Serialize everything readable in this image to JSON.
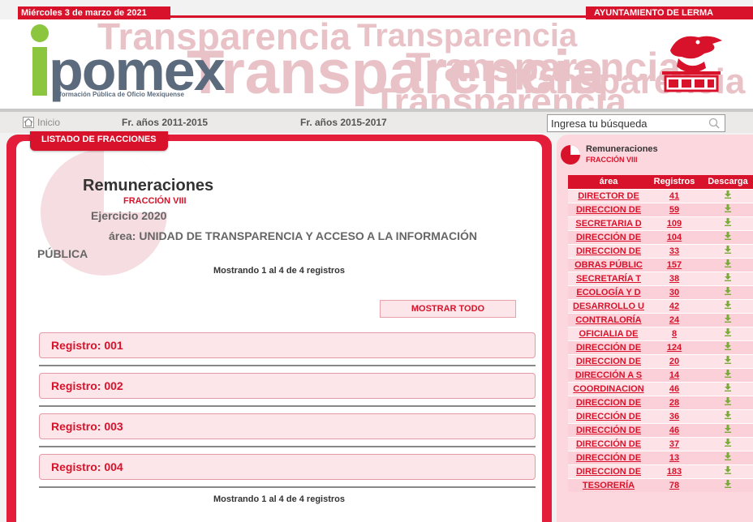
{
  "topbar": {
    "date": "Miércoles 3 de marzo de 2021",
    "ayuntamiento": "AYUNTAMIENTO DE LERMA"
  },
  "banner": {
    "logo_word": "pomex",
    "logo_sub": "Información Pública de Oficio Mexiquense",
    "watermark": "Transparencia"
  },
  "nav": {
    "home": "Inicio",
    "link1": "Fr. años 2011-2015",
    "link2": "Fr. años 2015-2017",
    "search_placeholder": "Ingresa tu búsqueda"
  },
  "main": {
    "tab": "LISTADO DE FRACCIONES",
    "title": "Remuneraciones",
    "fraccion": "FRACCIÓN VIII",
    "ejercicio": "Ejercicio 2020",
    "area": "área: UNIDAD DE TRANSPARENCIA Y ACCESO A LA INFORMACIÓN PÚBLICA",
    "mostrando": "Mostrando 1 al 4 de 4 registros",
    "mostrar_todo": "MOSTRAR TODO",
    "registros": [
      "Registro: 001",
      "Registro: 002",
      "Registro: 003",
      "Registro: 004"
    ]
  },
  "sidebar": {
    "title": "Remuneraciones",
    "fraccion": "FRACCIÓN VIII",
    "columns": [
      "área",
      "Registros",
      "Descarga"
    ],
    "rows": [
      {
        "area": "DIRECTOR DE",
        "registros": "41"
      },
      {
        "area": "DIRECCION DE",
        "registros": "59"
      },
      {
        "area": "SECRETARIA D",
        "registros": "109"
      },
      {
        "area": "DIRECCIÓN DE",
        "registros": "104"
      },
      {
        "area": "DIRECCION DE",
        "registros": "33"
      },
      {
        "area": "OBRAS PÚBLIC",
        "registros": "157"
      },
      {
        "area": "SECRETARÍA T",
        "registros": "38"
      },
      {
        "area": "ECOLOGÍA Y D",
        "registros": "30"
      },
      {
        "area": "DESARROLLO U",
        "registros": "42"
      },
      {
        "area": "CONTRALORÍA",
        "registros": "24"
      },
      {
        "area": "OFICIALIA DE",
        "registros": "8"
      },
      {
        "area": "DIRECCIÓN DE",
        "registros": "124"
      },
      {
        "area": "DIRECCION DE",
        "registros": "20"
      },
      {
        "area": "DIRECCIÓN A S",
        "registros": "14"
      },
      {
        "area": "COORDINACION",
        "registros": "46"
      },
      {
        "area": "DIRECCION DE",
        "registros": "28"
      },
      {
        "area": "DIRECCIÓN DE",
        "registros": "36"
      },
      {
        "area": "DIRECCIÓN DE",
        "registros": "46"
      },
      {
        "area": "DIRECCIÓN DE",
        "registros": "37"
      },
      {
        "area": "DIRECCIÓN DE",
        "registros": "13"
      },
      {
        "area": "DIRECCION DE",
        "registros": "183"
      },
      {
        "area": "TESORERÍA",
        "registros": "78"
      }
    ]
  },
  "colors": {
    "accent": "#d8122a",
    "logo_green": "#8cc63f",
    "logo_gray": "#5b6b7d",
    "download": "#7aab38"
  }
}
